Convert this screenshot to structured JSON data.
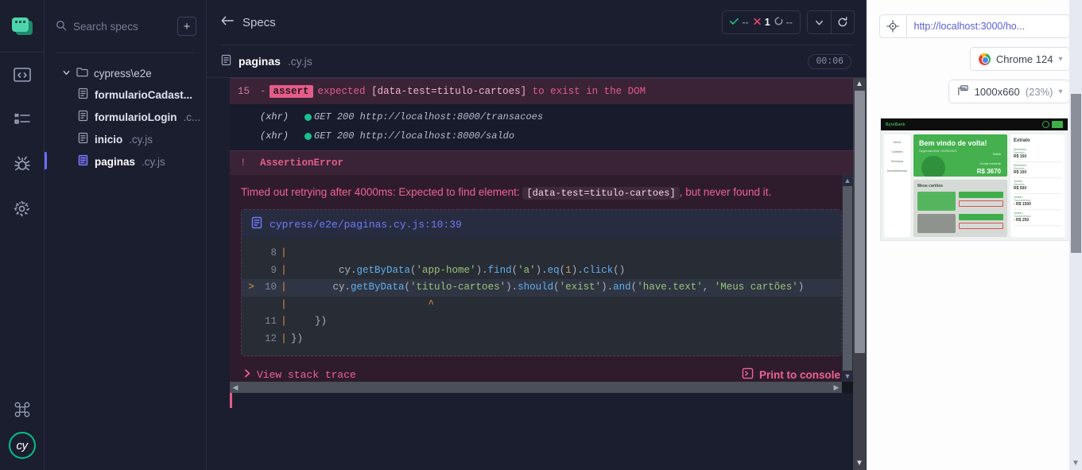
{
  "rail": {
    "logo_name": "cypress-logo",
    "items": [
      {
        "name": "browser-preview-icon",
        "title": "Specs"
      },
      {
        "name": "runs-icon",
        "title": "Runs"
      },
      {
        "name": "debug-bug-icon",
        "title": "Debug"
      },
      {
        "name": "settings-gear-icon",
        "title": "Settings"
      }
    ],
    "keyboard_icon": "command-key-icon",
    "cy_badge": "cy"
  },
  "sidebar": {
    "search": {
      "placeholder": "Search specs",
      "value": ""
    },
    "add_spec_label": "+",
    "tree": {
      "folder": "cypress\\e2e",
      "files": [
        {
          "name": "formularioCadast...",
          "ext": "",
          "active": false
        },
        {
          "name": "formularioLogin",
          "ext": ".c...",
          "active": false
        },
        {
          "name": "inicio",
          "ext": ".cy.js",
          "active": false
        },
        {
          "name": "paginas",
          "ext": ".cy.js",
          "active": true
        }
      ]
    }
  },
  "runner": {
    "back_label": "Specs",
    "stats": {
      "passed": "--",
      "failed": "1",
      "pending": "--"
    },
    "spec": {
      "name": "paginas",
      "ext": ".cy.js",
      "duration": "00:06"
    },
    "log": {
      "assert_row": {
        "number": "15",
        "dash": "-",
        "keyword": "assert",
        "text_before": "expected",
        "selector": "[data-test=titulo-cartoes]",
        "text_after": "to exist in the DOM"
      },
      "xhr_rows": [
        {
          "tag": "(xhr)",
          "method": "GET",
          "status": "200",
          "url": "http://localhost:8000/transacoes"
        },
        {
          "tag": "(xhr)",
          "method": "GET",
          "status": "200",
          "url": "http://localhost:8000/saldo"
        }
      ],
      "error_label": "AssertionError"
    },
    "error": {
      "message_pre": "Timed out retrying after 4000ms: Expected to find element:",
      "message_selector": "[data-test=titulo-cartoes]",
      "message_post": ", but never found it.",
      "code_file": "cypress/e2e/paginas.cy.js:10:39",
      "code_lines": [
        {
          "arrow": "",
          "ln": "8",
          "bar": "|",
          "src": "",
          "highlight": false
        },
        {
          "arrow": "",
          "ln": "9",
          "bar": "|",
          "src": "        cy.getByData('app-home').find('a').eq(1).click()",
          "highlight": false
        },
        {
          "arrow": ">",
          "ln": "10",
          "bar": "|",
          "src": "       cy.getByData('titulo-cartoes').should('exist').and('have.text', 'Meus cartões')",
          "highlight": true
        },
        {
          "arrow": "",
          "ln": "",
          "bar": "|",
          "src": "                       ^",
          "highlight": false,
          "caret": true
        },
        {
          "arrow": "",
          "ln": "11",
          "bar": "|",
          "src": "    })",
          "highlight": false
        },
        {
          "arrow": "",
          "ln": "12",
          "bar": "|",
          "src": "})",
          "highlight": false
        }
      ],
      "view_stack_label": "View stack trace",
      "print_console_label": "Print to console"
    }
  },
  "preview": {
    "url": "http://localhost:3000/ho...",
    "selector_icon": "crosshair-selector-icon",
    "browser": {
      "label": "Chrome 124",
      "icon": "chrome-icon"
    },
    "viewport": {
      "label": "1000x660",
      "scale": "(23%)",
      "icon": "ruler-icon"
    },
    "app": {
      "brand": "ByteBank",
      "nav": [
        "Início",
        "Cartões",
        "Serviços",
        "Investimentos"
      ],
      "hero_title": "Bem vindo de volta!",
      "hero_sub": "Segunda-feira, 02/05/2024",
      "balance_label": "Saldo",
      "account_label": "Conta corrente",
      "balance_value": "R$ 3670",
      "cards_title": "Meus cartões",
      "card1_label": "Cartão físico",
      "card2_label": "Cartão digital",
      "btn_config": "Configurar",
      "btn_block": "Bloquear",
      "note1": "Função: Débito/Crédito",
      "note2": "Função: Débito",
      "statement_title": "Extrato",
      "statements": [
        {
          "month": "Novembro",
          "type": "Depósito",
          "date": "18/11/2022",
          "value": "R$ 150"
        },
        {
          "month": "Novembro",
          "type": "Depósito",
          "date": "21/11/2022",
          "value": "R$ 100"
        },
        {
          "month": "Janeiro",
          "type": "Depósito",
          "date": "21/01/2023",
          "value": "R$ 500"
        },
        {
          "month": "Janeiro",
          "type": "Transferência",
          "date": "21/01/2023",
          "value": "- R$ 1500"
        },
        {
          "month": "Janeiro",
          "type": "Transferência",
          "date": "21/01/2023",
          "value": "- R$ 250"
        }
      ]
    }
  },
  "colors": {
    "accent_pink": "#e45c89",
    "error_bg": "#2e1c2d",
    "pass_green": "#18c08f",
    "link_purple": "#6f7bf7",
    "panel_dark": "#1b1e2e"
  }
}
